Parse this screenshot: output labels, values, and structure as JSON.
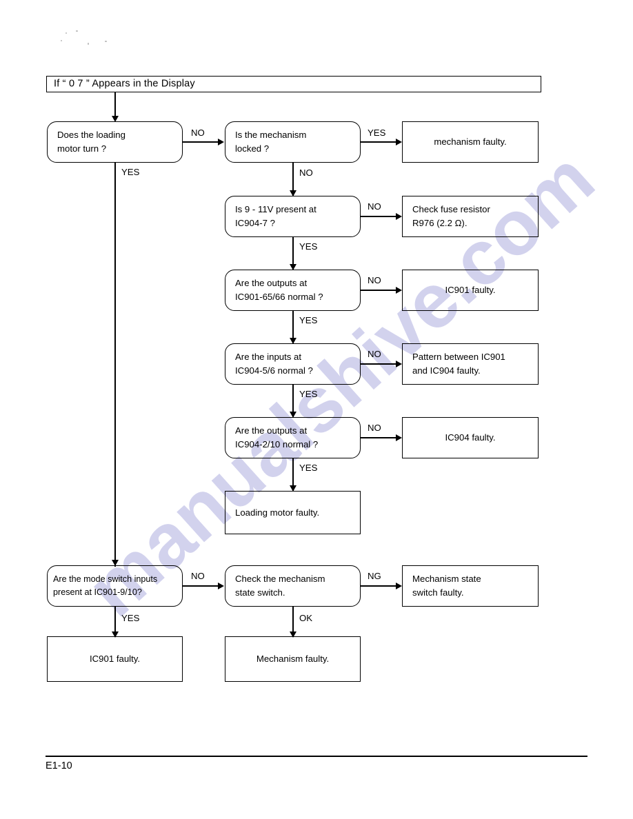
{
  "page": {
    "footer_rule": true,
    "page_number": "E1-10",
    "watermark_text": "manualshive.com",
    "watermark_color": "#c9c9ea",
    "ink_color": "#000000",
    "background_color": "#ffffff"
  },
  "title": {
    "text": "If “ 0 7 ”  Appears in the Display"
  },
  "chart_data": {
    "type": "diagram",
    "diagram_kind": "troubleshooting-flowchart",
    "title": "If “ 0 7 ”  Appears in the Display",
    "nodes": [
      {
        "id": "n1",
        "shape": "decision",
        "text": "Does the loading\nmotor turn ?"
      },
      {
        "id": "n2",
        "shape": "decision",
        "text": "Is the mechanism\nlocked ?"
      },
      {
        "id": "n3",
        "shape": "terminal",
        "text": "mechanism faulty."
      },
      {
        "id": "n4",
        "shape": "decision",
        "text": "Is 9 - 11V present at\nIC904-7 ?"
      },
      {
        "id": "n5",
        "shape": "terminal",
        "text": "Check fuse resistor\nR976 (2.2 Ω)."
      },
      {
        "id": "n6",
        "shape": "decision",
        "text": "Are the outputs at\nIC901-65/66 normal ?"
      },
      {
        "id": "n7",
        "shape": "terminal",
        "text": "IC901 faulty."
      },
      {
        "id": "n8",
        "shape": "decision",
        "text": "Are the inputs at\nIC904-5/6 normal ?"
      },
      {
        "id": "n9",
        "shape": "terminal",
        "text": "Pattern between IC901\nand IC904 faulty."
      },
      {
        "id": "n10",
        "shape": "decision",
        "text": "Are the outputs at\nIC904-2/10 normal ?"
      },
      {
        "id": "n11",
        "shape": "terminal",
        "text": "IC904 faulty."
      },
      {
        "id": "n12",
        "shape": "terminal",
        "text": "Loading motor faulty."
      },
      {
        "id": "n13",
        "shape": "decision",
        "text": "Are the mode switch inputs\npresent at IC901-9/10?"
      },
      {
        "id": "n14",
        "shape": "decision",
        "text": "Check the mechanism\nstate switch."
      },
      {
        "id": "n15",
        "shape": "terminal",
        "text": "Mechanism state\nswitch faulty."
      },
      {
        "id": "n16",
        "shape": "terminal",
        "text": "IC901 faulty."
      },
      {
        "id": "n17",
        "shape": "terminal",
        "text": "Mechanism faulty."
      }
    ],
    "edges": [
      {
        "from": "title",
        "to": "n1",
        "label": ""
      },
      {
        "from": "n1",
        "to": "n2",
        "label": "NO"
      },
      {
        "from": "n1",
        "to": "n13",
        "label": "YES"
      },
      {
        "from": "n2",
        "to": "n3",
        "label": "YES"
      },
      {
        "from": "n2",
        "to": "n4",
        "label": "NO"
      },
      {
        "from": "n4",
        "to": "n5",
        "label": "NO"
      },
      {
        "from": "n4",
        "to": "n6",
        "label": "YES"
      },
      {
        "from": "n6",
        "to": "n7",
        "label": "NO"
      },
      {
        "from": "n6",
        "to": "n8",
        "label": "YES"
      },
      {
        "from": "n8",
        "to": "n9",
        "label": "NO"
      },
      {
        "from": "n8",
        "to": "n10",
        "label": "YES"
      },
      {
        "from": "n10",
        "to": "n11",
        "label": "NO"
      },
      {
        "from": "n10",
        "to": "n12",
        "label": "YES"
      },
      {
        "from": "n13",
        "to": "n14",
        "label": "NO"
      },
      {
        "from": "n13",
        "to": "n16",
        "label": "YES"
      },
      {
        "from": "n14",
        "to": "n15",
        "label": "NG"
      },
      {
        "from": "n14",
        "to": "n17",
        "label": "OK"
      }
    ]
  },
  "branch_labels": {
    "b1_no": "NO",
    "b1_yes": "YES",
    "b2_yes": "YES",
    "b2_no": "NO",
    "b4_no": "NO",
    "b4_yes": "YES",
    "b6_no": "NO",
    "b6_yes": "YES",
    "b8_no": "NO",
    "b8_yes": "YES",
    "b10_no": "NO",
    "b10_yes": "YES",
    "b13_no": "NO",
    "b13_yes": "YES",
    "b14_ng": "NG",
    "b14_ok": "OK"
  }
}
